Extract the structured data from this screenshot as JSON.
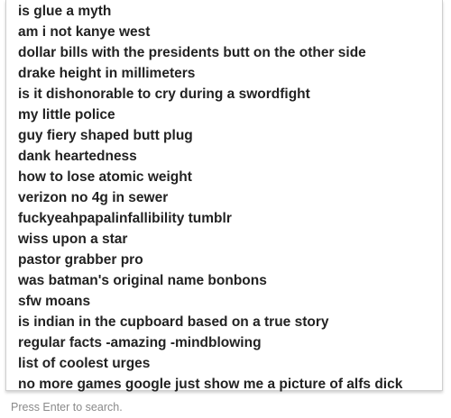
{
  "suggestions": [
    "is glue a myth",
    "am i not kanye west",
    "dollar bills with the presidents butt on the other side",
    "drake height in millimeters",
    "is it dishonorable to cry during a swordfight",
    "my little police",
    "guy fiery shaped butt plug",
    "dank heartedness",
    "how to lose atomic weight",
    "verizon no 4g in sewer",
    "fuckyeahpapalinfallibility tumblr",
    "wiss upon a star",
    "pastor grabber pro",
    "was batman's original name bonbons",
    "sfw moans",
    "is indian in the cupboard based on a true story",
    "regular facts -amazing -mindblowing",
    "list of coolest urges",
    "no more games google just show me a picture of alfs dick"
  ],
  "footer": {
    "hint": "Press Enter to search."
  }
}
